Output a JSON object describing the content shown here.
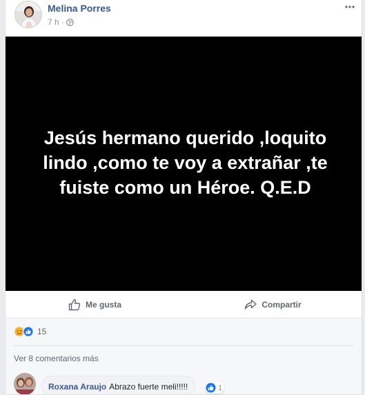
{
  "post": {
    "author": "Melina Porres",
    "time": "7 h",
    "separator": "·",
    "text": "Jesús hermano querido ,loquito lindo ,como te voy a extrañar ,te fuiste como un Héroe. Q.E.D"
  },
  "actions": {
    "like_label": "Me gusta",
    "share_label": "Compartir"
  },
  "reactions": {
    "icons": [
      "sad-icon",
      "like-icon"
    ],
    "count": "15"
  },
  "comments_section": {
    "more_link": "Ver 8 comentarios más",
    "comment": {
      "author": "Roxana Araujo",
      "text": "Abrazo fuerte meli!!!!!",
      "like_count": "1"
    }
  },
  "colors": {
    "link_blue": "#365899",
    "like_blue": "#1877f2",
    "sad_yellow": "#f7b125",
    "post_background": "#000000"
  }
}
